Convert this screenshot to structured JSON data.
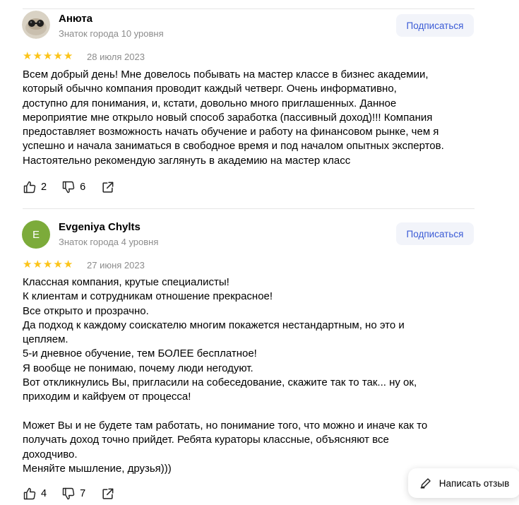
{
  "reviews": [
    {
      "author": "Анюта",
      "level": "Знаток города 10 уровня",
      "avatar_type": "photo",
      "subscribe_label": "Подписаться",
      "rating": 5,
      "date": "28 июля 2023",
      "text": "Всем добрый день! Мне довелось побывать на мастер классе в бизнес академии,\nкоторый обычно компания проводит каждый четверг. Очень информативно,\nдоступно для понимания, и, кстати, довольно много приглашенных. Данное\nмероприятие мне открыло новый способ заработка (пассивный доход)!!! Компания\nпредоставляет возможность начать обучение и работу на финансовом рынке, чем я\nуспешно и начала заниматься в свободное время и под началом опытных экспертов.\nНастоятельно рекомендую заглянуть в академию на мастер класс",
      "likes": "2",
      "dislikes": "6"
    },
    {
      "author": "Evgeniya Chylts",
      "level": "Знаток города 4 уровня",
      "avatar_type": "letter",
      "avatar_letter": "E",
      "avatar_color": "#7cab3a",
      "subscribe_label": "Подписаться",
      "rating": 5,
      "date": "27 июня 2023",
      "text": "Классная компания, крутые специалисты!\nК клиентам и сотрудникам отношение прекрасное!\nВсе открыто и прозрачно.\nДа подход к каждому соискателю многим покажется нестандартным, но это и\nцепляем.\n5-и дневное обучение, тем БОЛЕЕ бесплатное!\nЯ вообще не понимаю, почему люди негодуют.\nВот откликнулись Вы, пригласили на собеседование, скажите так то так... ну ок,\nприходим и кайфуем от процесса!\n\nМожет Вы и не будете там работать, но понимание того, что можно и иначе как то\nполучать доход точно прийдет. Ребята кураторы классные, объясняют все\nдоходчиво.\nМеняйте мышление, друзья)))",
      "likes": "4",
      "dislikes": "7"
    }
  ],
  "write_review_label": "Написать отзыв",
  "colors": {
    "star": "#fcc419",
    "subscribe_text": "#3b5bd6",
    "subscribe_bg": "#f2f4fa",
    "muted": "#8c8c8c"
  },
  "icons": {
    "like": "thumb-up-icon",
    "dislike": "thumb-down-icon",
    "share": "share-icon",
    "write": "pencil-icon",
    "star": "star-icon"
  }
}
